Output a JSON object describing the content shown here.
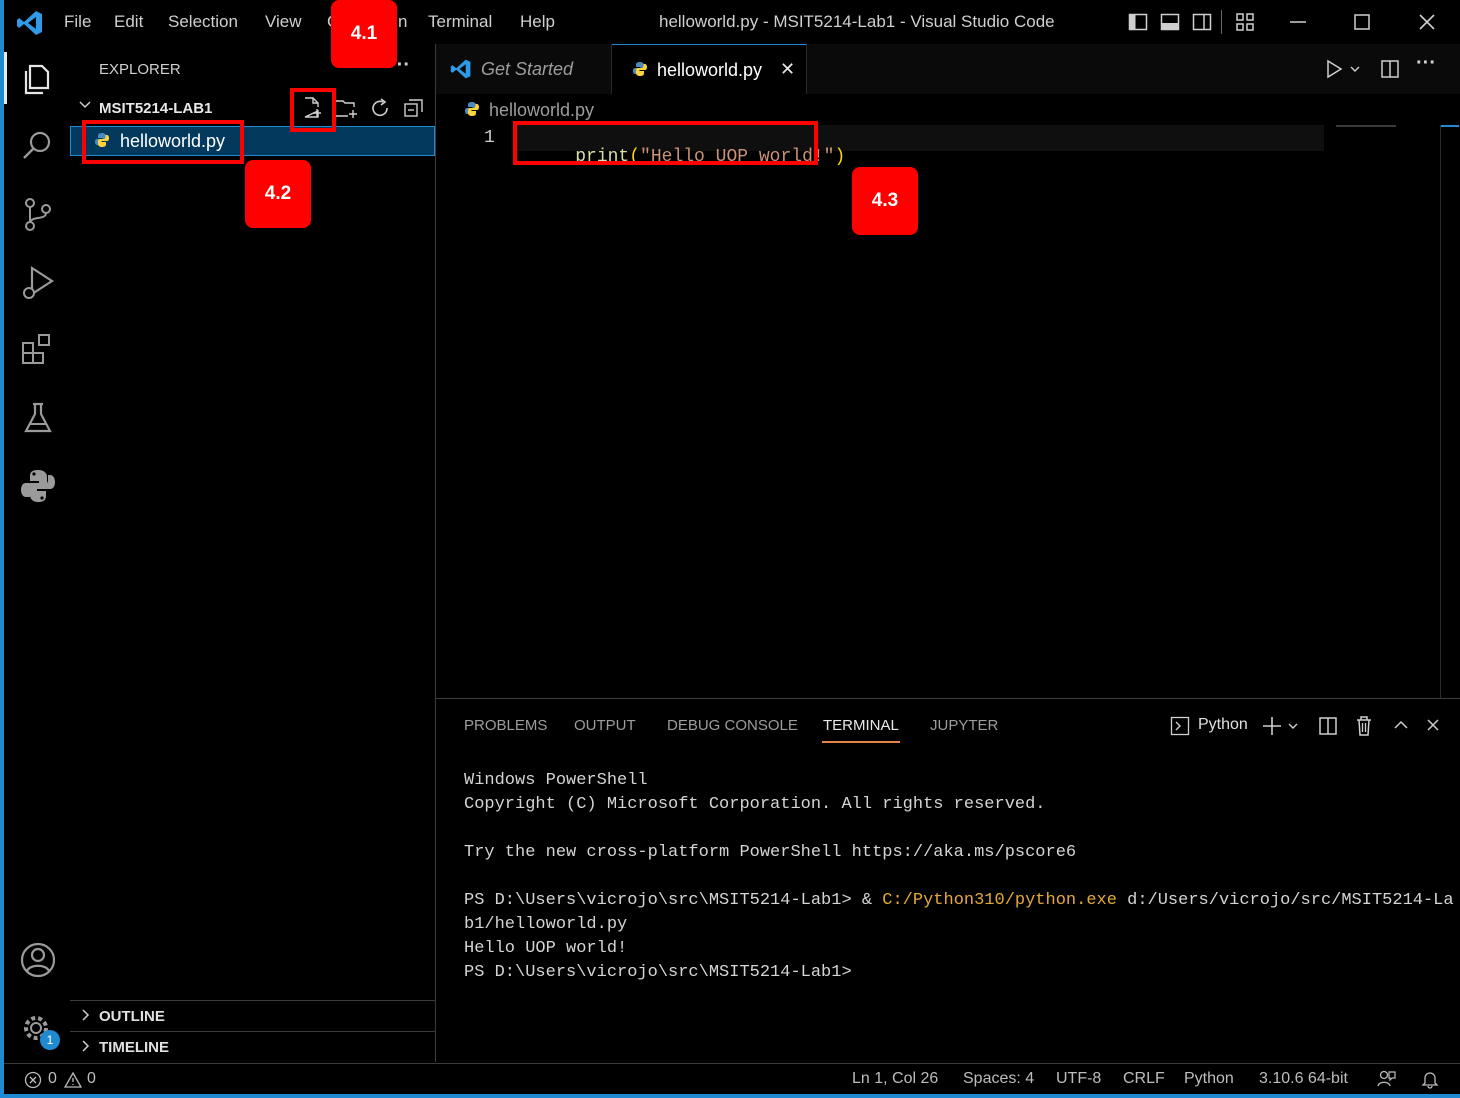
{
  "titlebar": {
    "menu": [
      "File",
      "Edit",
      "Selection",
      "View",
      "G",
      "n",
      "Terminal",
      "Help"
    ],
    "window_title": "helloworld.py - MSIT5214-Lab1 - Visual Studio Code"
  },
  "sidebar": {
    "title": "EXPLORER",
    "more": "···",
    "folder_name": "MSIT5214-LAB1",
    "files": [
      {
        "name": "helloworld.py",
        "icon": "python-file-icon",
        "selected": true
      }
    ],
    "outline_label": "OUTLINE",
    "timeline_label": "TIMELINE"
  },
  "tabs": [
    {
      "label": "Get Started",
      "icon": "vscode-logo-icon",
      "active": false
    },
    {
      "label": "helloworld.py",
      "icon": "python-file-icon",
      "active": true,
      "close": "✕"
    }
  ],
  "editor": {
    "breadcrumb": "helloworld.py",
    "lines": [
      {
        "number": "1",
        "func": "print",
        "open": "(",
        "string": "\"Hello UOP world!\"",
        "close": ")"
      }
    ]
  },
  "panel": {
    "tabs": [
      "PROBLEMS",
      "OUTPUT",
      "DEBUG CONSOLE",
      "TERMINAL",
      "JUPYTER"
    ],
    "active_tab": "TERMINAL",
    "terminal_profile": "Python",
    "terminal": {
      "line1": "Windows PowerShell",
      "line2": "Copyright (C) Microsoft Corporation. All rights reserved.",
      "line3": "Try the new cross-platform PowerShell https://aka.ms/pscore6",
      "prompt1": "PS D:\\Users\\vicrojo\\src\\MSIT5214-Lab1> & ",
      "exe": "C:/Python310/python.exe",
      "arg": " d:/Users/vicrojo/src/MSIT5214-La",
      "line5": "b1/helloworld.py",
      "line6": "Hello UOP world!",
      "prompt2": "PS D:\\Users\\vicrojo\\src\\MSIT5214-Lab1>"
    }
  },
  "statusbar": {
    "errors": "0",
    "warnings": "0",
    "position": "Ln 1, Col 26",
    "spaces": "Spaces: 4",
    "encoding": "UTF-8",
    "eol": "CRLF",
    "language": "Python",
    "interpreter": "3.10.6 64-bit"
  },
  "settings_badge": "1",
  "annotations": [
    {
      "label": "4.1",
      "target": "new-file-button"
    },
    {
      "label": "4.2",
      "target": "helloworld.py file"
    },
    {
      "label": "4.3",
      "target": "code line 1"
    }
  ],
  "colors": {
    "accent": "#1f8ad2",
    "annotation": "#ff0000",
    "keyword": "#dcdcaa",
    "string": "#ce9178",
    "exe_highlight": "#e5a83b"
  }
}
